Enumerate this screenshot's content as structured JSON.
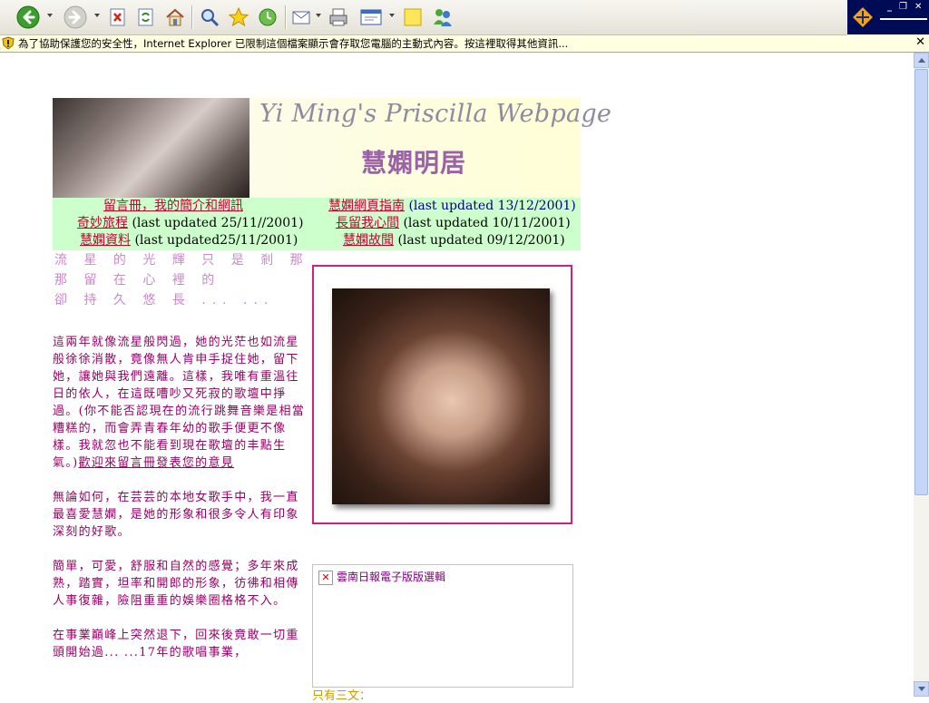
{
  "toolbar": {
    "buttons": [
      {
        "name": "back-button",
        "icon": "back-arrow-icon"
      },
      {
        "name": "forward-button",
        "icon": "forward-arrow-icon"
      },
      {
        "name": "stop-button",
        "icon": "stop-icon"
      },
      {
        "name": "refresh-button",
        "icon": "refresh-icon"
      },
      {
        "name": "home-button",
        "icon": "home-icon"
      },
      {
        "name": "search-button",
        "icon": "search-icon"
      },
      {
        "name": "favorites-button",
        "icon": "star-icon"
      },
      {
        "name": "history-button",
        "icon": "history-icon"
      },
      {
        "name": "mail-button",
        "icon": "mail-icon"
      },
      {
        "name": "print-button",
        "icon": "printer-icon"
      },
      {
        "name": "edit-button",
        "icon": "edit-icon"
      },
      {
        "name": "discuss-button",
        "icon": "note-icon"
      },
      {
        "name": "messenger-button",
        "icon": "messenger-icon"
      }
    ]
  },
  "infobar": {
    "message": "為了協助保護您的安全性，Internet Explorer 已限制這個檔案顯示會存取您電腦的主動式內容。按這裡取得其他資訊..."
  },
  "banner": {
    "title": "Yi Ming's Priscilla Webpage",
    "chinese_title": "慧嫻明居"
  },
  "nav": {
    "guestbook": {
      "label": "留言冊，我的簡介和網訊",
      "note": ""
    },
    "guide": {
      "label": "慧嫻網頁指南",
      "note": "(last updated 13/12/2001)"
    },
    "journey": {
      "label": "奇妙旅程",
      "note": "(last updated 25/11//2001)"
    },
    "heart": {
      "label": "長留我心間",
      "note": "(last updated 10/11/2001)"
    },
    "info": {
      "label": "慧嫻資料",
      "note": "(last updated25/11/2001)"
    },
    "story": {
      "label": "慧嫻故聞",
      "note": "(last updated 09/12/2001)"
    }
  },
  "poem": {
    "line1": "流 星 的 光 輝 只 是 剎 那",
    "line2": "那 留 在 心 裡 的",
    "line3": "卻 持 久 悠 長 ... ..."
  },
  "article": {
    "p1": "這兩年就像流星般閃過，她的光茫也如流星般徐徐消散，竟像無人肯申手捉住她，留下她，讓她與我們遠離。這樣，我唯有重溫往日的依人，在這既嘈吵又死寂的歌壇中掙過。(你不能否認現在的流行跳舞音樂是相當糟糕的，而會弄青春年幼的歌手便更不像樣。我就忽也不能看到現在歌壇的丰點生氣。)",
    "p1_link": "歡迎來留言冊發表您的意見",
    "p2": "無論如何，在芸芸的本地女歌手中，我一直最喜愛慧嫻，是她的形象和很多令人有印象深刻的好歌。",
    "p3": "簡單，可愛，舒服和自然的感覺；多年來成熟，踏實，坦率和開郎的形象，彷彿和相傳人事復雜，險阻重重的娛樂圈格格不入。",
    "p4": "在事業巔峰上突然退下，回來後竟敢一切重頭開始過... ...17年的歌唱事業，"
  },
  "news": {
    "label": "雲南日報電子版版選輯"
  },
  "more": {
    "text": "只有三文："
  },
  "colors": {
    "nav_bg": "#ccffcc",
    "link": "#cc0033",
    "article_text": "#990066",
    "frame_border": "#d4207a"
  }
}
